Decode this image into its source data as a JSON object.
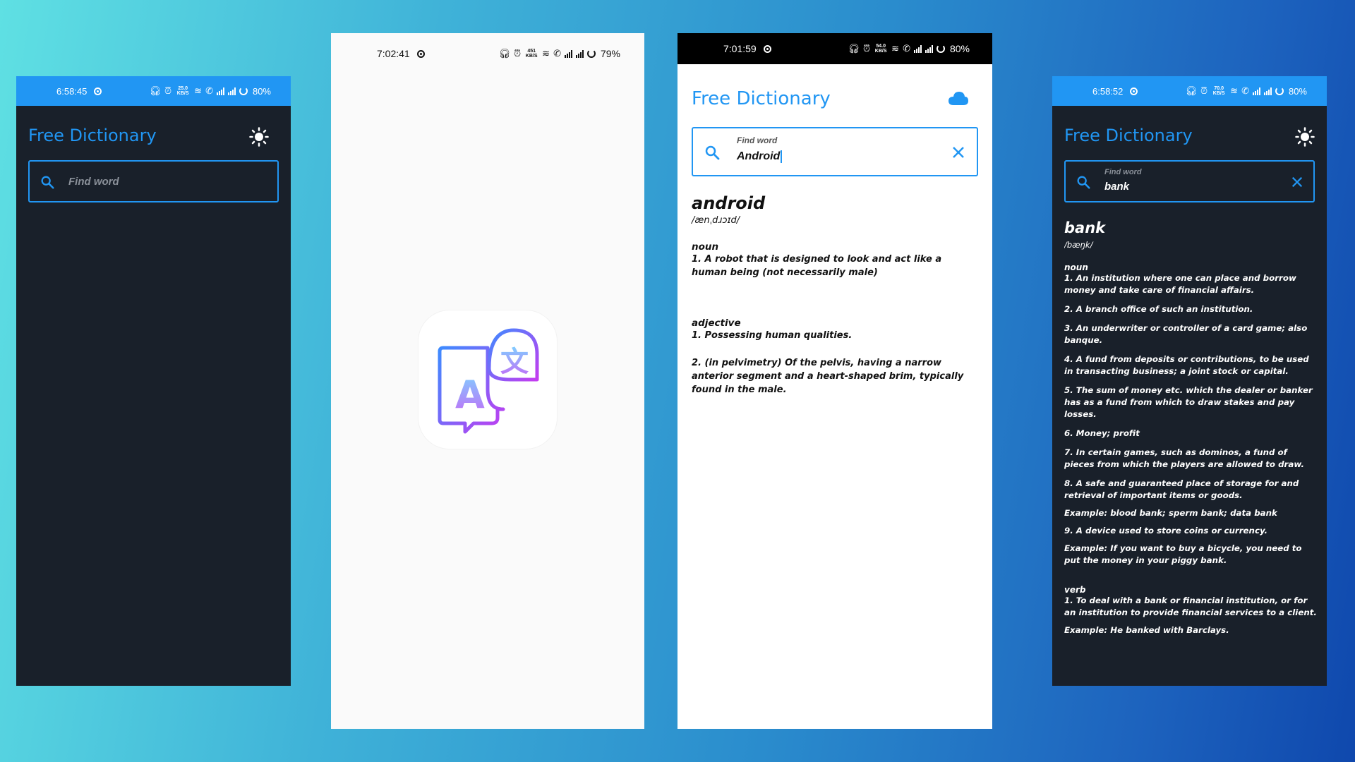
{
  "colors": {
    "accent": "#2196f3",
    "dark_bg": "#19202a",
    "light_bg": "#ffffff",
    "splash_bg": "#fafafa"
  },
  "screens": [
    {
      "status": {
        "time": "6:58:45",
        "speed": "25.0 KB/S",
        "battery": "80%"
      },
      "app_title": "Free Dictionary",
      "theme_icon": "sun-icon",
      "search": {
        "placeholder": "Find word",
        "value": ""
      }
    },
    {
      "status": {
        "time": "7:02:41",
        "speed": "451 KB/S",
        "battery": "79%"
      },
      "splash_icon": "translate-chat-icon",
      "splash_letters": {
        "a": "A",
        "b": "文"
      }
    },
    {
      "status": {
        "time": "7:01:59",
        "speed": "54.0 KB/S",
        "battery": "80%"
      },
      "app_title": "Free Dictionary",
      "theme_icon": "cloud-icon",
      "search": {
        "label": "Find word",
        "value": "Android"
      },
      "result": {
        "word": "android",
        "phonetic": "/ænˌdɹɔɪd/",
        "meanings": [
          {
            "pos": "noun",
            "definitions": [
              "1. A robot that is designed to look and act like a human being (not necessarily male)"
            ]
          },
          {
            "pos": "adjective",
            "definitions": [
              "1. Possessing human qualities.",
              "2. (in pelvimetry) Of the pelvis, having a narrow anterior segment and a heart-shaped brim, typically found in the male."
            ]
          }
        ]
      }
    },
    {
      "status": {
        "time": "6:58:52",
        "speed": "70.0 KB/S",
        "battery": "80%"
      },
      "app_title": "Free Dictionary",
      "theme_icon": "sun-icon",
      "search": {
        "label": "Find word",
        "value": "bank"
      },
      "result": {
        "word": "bank",
        "phonetic": "/bæŋk/",
        "noun_pos": "noun",
        "noun_defs": [
          "1. An institution where one can place and borrow money and take care of financial affairs.",
          "2. A branch office of such an institution.",
          "3. An underwriter or controller of a card game; also banque.",
          "4. A fund from deposits or contributions, to be used in transacting business; a joint stock or capital.",
          "5. The sum of money etc. which the dealer or banker has as a fund from which to draw stakes and pay losses.",
          "6. Money; profit",
          "7. In certain games, such as dominos, a fund of pieces from which the players are allowed to draw.",
          "8. A safe and guaranteed place of storage for and retrieval of important items or goods."
        ],
        "example_8": "Example: blood bank; sperm bank; data bank",
        "noun_def_9": "9. A device used to store coins or currency.",
        "example_9": "Example: If you want to buy a bicycle, you need to put the money in your piggy bank.",
        "verb_pos": "verb",
        "verb_def_1": "1. To deal with a bank or financial institution, or for an institution to provide financial services to a client.",
        "verb_example_1": "Example: He banked with Barclays."
      }
    }
  ]
}
